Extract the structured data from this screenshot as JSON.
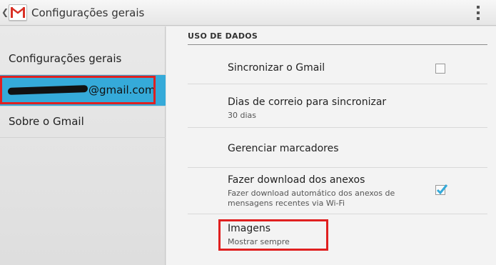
{
  "actionbar": {
    "title": "Configurações gerais",
    "back_glyph": "❮",
    "logo_icon": "gmail-logo-icon",
    "menu_icon": "overflow-menu-icon"
  },
  "sidebar": {
    "items": [
      {
        "label": "Configurações gerais"
      },
      {
        "label": "@gmail.com",
        "selected": true
      },
      {
        "label": "Sobre o Gmail"
      }
    ]
  },
  "settings": {
    "section_title": "USO DE DADOS",
    "rows": [
      {
        "title": "Sincronizar o Gmail",
        "checked": false
      },
      {
        "title": "Dias de correio para sincronizar",
        "subtitle": "30 dias"
      },
      {
        "title": "Gerenciar marcadores"
      },
      {
        "title": "Fazer download dos anexos",
        "subtitle": "Fazer download automático dos anexos de mensagens recentes via Wi-Fi",
        "checked": true
      },
      {
        "title": "Imagens",
        "subtitle": "Mostrar sempre"
      }
    ]
  },
  "colors": {
    "selected": "#35aad9",
    "highlight": "#e02020",
    "check": "#35aad9"
  }
}
